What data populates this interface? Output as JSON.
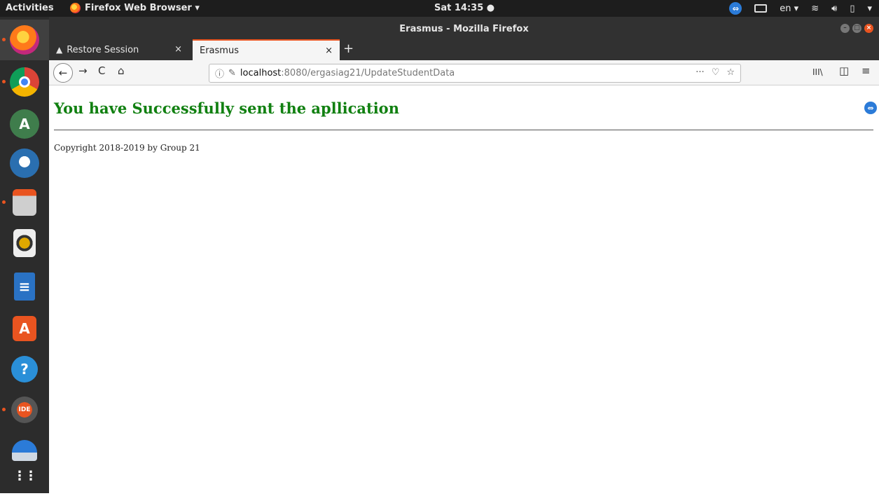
{
  "topbar": {
    "activities": "Activities",
    "app_menu": "Firefox Web Browser ▾",
    "clock": "Sat 14:35 ●",
    "language": "en ▾",
    "system_menu": "▾"
  },
  "window": {
    "title": "Erasmus - Mozilla Firefox"
  },
  "tabs": [
    {
      "label": "Restore Session",
      "close": "×",
      "warn": "▲"
    },
    {
      "label": "Erasmus",
      "close": "×"
    }
  ],
  "newtab": "+",
  "nav": {
    "back": "←",
    "forward": "→",
    "reload": "C",
    "home": "⌂",
    "url_info": "ⓘ",
    "url_host": "localhost",
    "url_path": ":8080/ergasiag21/UpdateStudentData",
    "page_actions": "···",
    "pocket": "♡",
    "star": "☆",
    "library": "III\\",
    "sidebar": "◫",
    "menu": "≡"
  },
  "page": {
    "heading": "You have Successfully sent the apllication",
    "copyright": "Copyright 2018-2019 by Group 21"
  },
  "dock": [
    {
      "name": "firefox-icon",
      "color": "#e66000"
    },
    {
      "name": "chrome-icon",
      "color": "#4285f4"
    },
    {
      "name": "android-studio-icon",
      "color": "#3ddc84"
    },
    {
      "name": "thunderbird-icon",
      "color": "#2a6fb0"
    },
    {
      "name": "files-icon",
      "color": "#8a8a8a"
    },
    {
      "name": "rhythmbox-icon",
      "color": "#e0a800"
    },
    {
      "name": "libreoffice-writer-icon",
      "color": "#2a72c4"
    },
    {
      "name": "software-center-icon",
      "color": "#e95420"
    },
    {
      "name": "help-icon",
      "color": "#2a8fd8"
    },
    {
      "name": "java-ee-ide-icon",
      "color": "#555555"
    },
    {
      "name": "remote-desktop-icon",
      "color": "#2b7bd8"
    },
    {
      "name": "show-apps-icon",
      "color": "#2c2c2c"
    }
  ],
  "dock_labels": {
    "help": "?",
    "java": "IDE",
    "apps": "⋮⋮"
  }
}
